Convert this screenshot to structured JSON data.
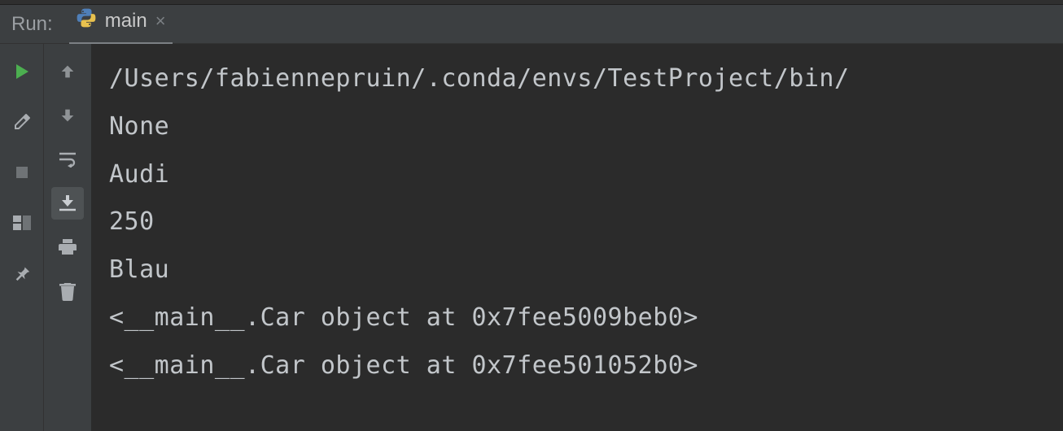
{
  "panel_label": "Run:",
  "tab": {
    "title": "main",
    "close_glyph": "×"
  },
  "console": {
    "lines": [
      "/Users/fabiennepruin/.conda/envs/TestProject/bin/",
      "None",
      "Audi",
      "250",
      "Blau",
      "<__main__.Car object at 0x7fee5009beb0>",
      "<__main__.Car object at 0x7fee501052b0>"
    ]
  },
  "icons": {
    "run": "run-icon",
    "wrench": "wrench-icon",
    "stop": "stop-icon",
    "layout": "layout-icon",
    "pin": "pin-icon",
    "up": "arrow-up-icon",
    "down": "arrow-down-icon",
    "wrap": "soft-wrap-icon",
    "scroll": "scroll-to-end-icon",
    "print": "print-icon",
    "trash": "trash-icon"
  }
}
